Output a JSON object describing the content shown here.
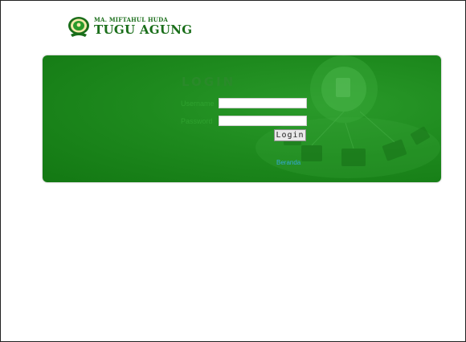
{
  "header": {
    "school_line1": "MA. MIFTAHUL HUDA",
    "school_line2": "TUGU AGUNG",
    "logo_icon": "school-emblem-icon"
  },
  "login": {
    "title": "LOGIN",
    "username_label": "Username",
    "password_label": "Password",
    "username_value": "",
    "password_value": "",
    "submit_label": "Login",
    "home_link": "Beranda"
  },
  "colors": {
    "panel_green": "#1e8a1e",
    "brand_green": "#1a6e1a",
    "link_blue": "#36a8d8"
  }
}
